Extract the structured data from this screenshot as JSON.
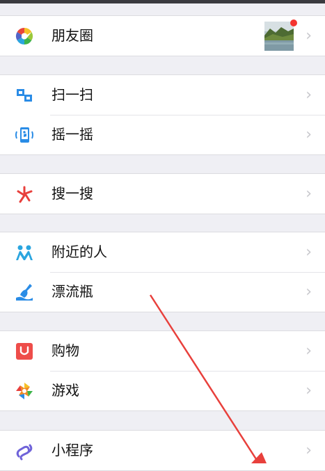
{
  "groups": [
    {
      "items": [
        {
          "label": "朋友圈",
          "icon": "moments-icon",
          "has_thumbnail": true,
          "badge_dot": true
        }
      ]
    },
    {
      "items": [
        {
          "label": "扫一扫",
          "icon": "scan-icon"
        },
        {
          "label": "摇一摇",
          "icon": "shake-icon"
        }
      ]
    },
    {
      "items": [
        {
          "label": "搜一搜",
          "icon": "search-icon"
        }
      ]
    },
    {
      "items": [
        {
          "label": "附近的人",
          "icon": "people-nearby-icon"
        },
        {
          "label": "漂流瓶",
          "icon": "drift-bottle-icon"
        }
      ]
    },
    {
      "items": [
        {
          "label": "购物",
          "icon": "shopping-icon"
        },
        {
          "label": "游戏",
          "icon": "games-icon"
        }
      ]
    },
    {
      "items": [
        {
          "label": "小程序",
          "icon": "mini-programs-icon"
        }
      ]
    }
  ],
  "colors": {
    "background": "#efeff4",
    "accent_red": "#f43530",
    "scan_blue": "#2a8ce6",
    "annotation_arrow": "#e8403c"
  }
}
